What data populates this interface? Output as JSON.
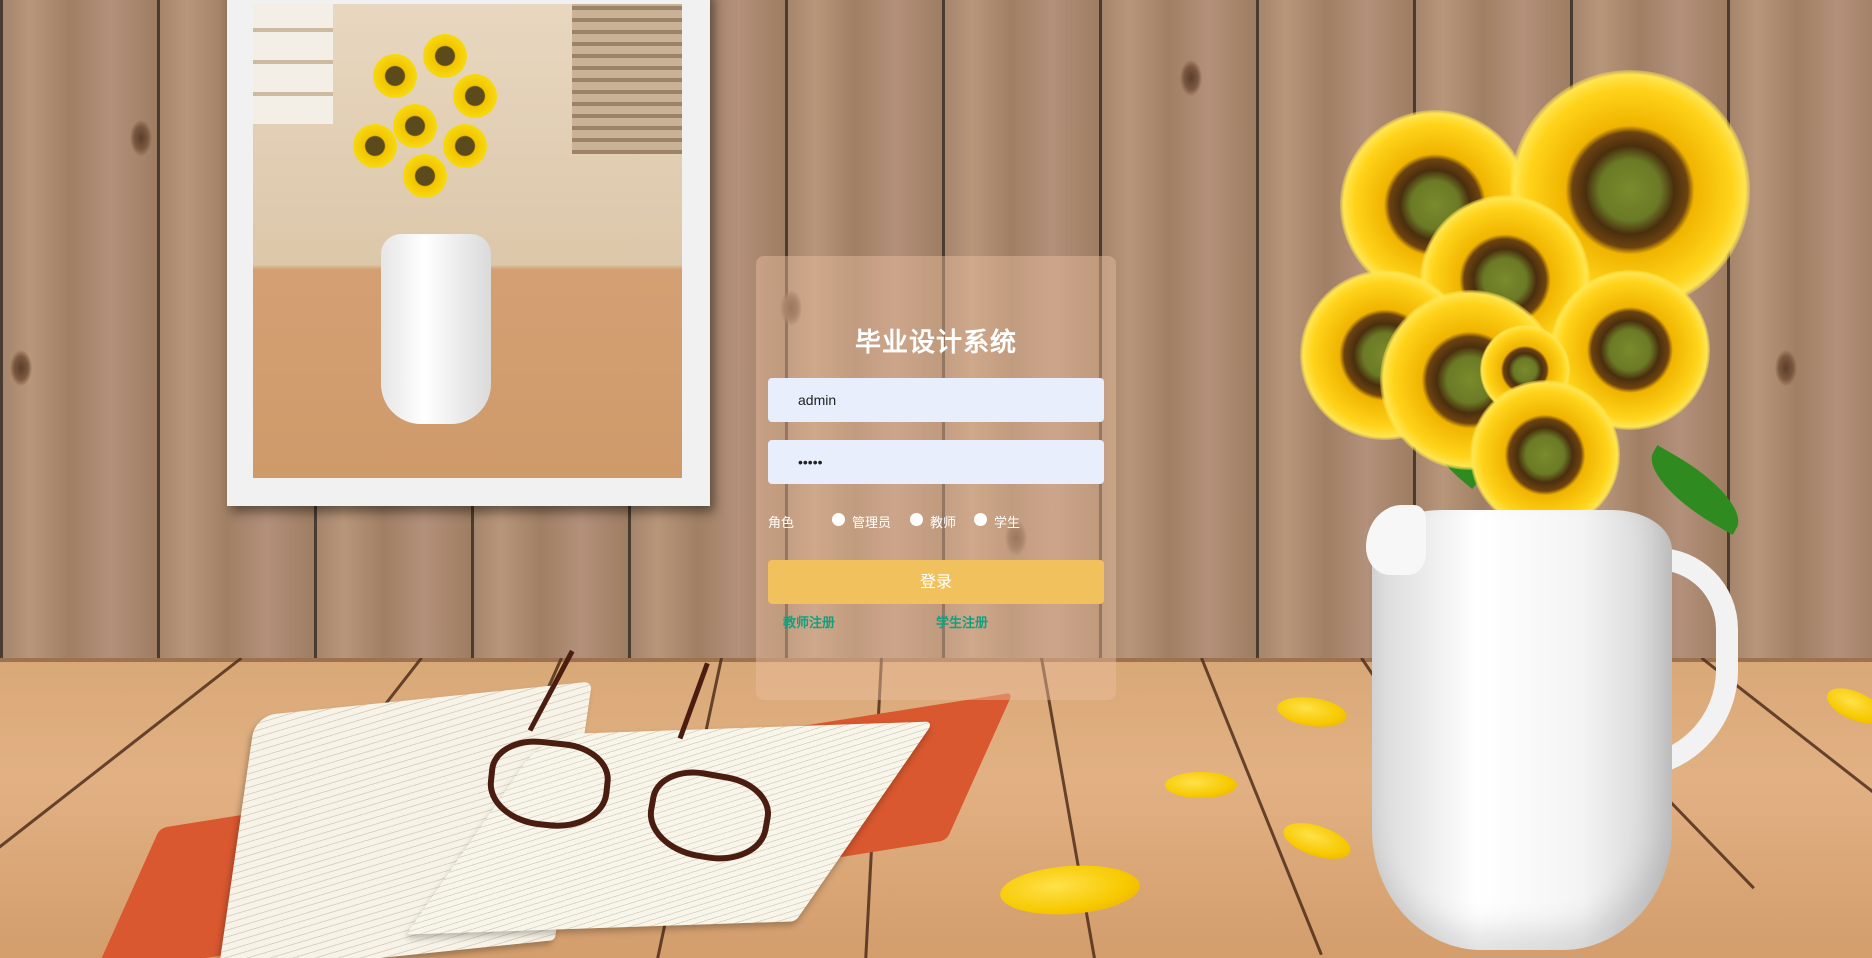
{
  "login": {
    "title": "毕业设计系统",
    "username_value": "admin",
    "password_value": "•••••",
    "role_label": "角色",
    "roles": [
      "管理员",
      "教师",
      "学生"
    ],
    "submit_label": "登录",
    "teacher_register": "教师注册",
    "student_register": "学生注册"
  },
  "colors": {
    "panel": "#ebbea0",
    "button": "#f0c15c",
    "link": "#12a07f",
    "input": "#e8eefc"
  }
}
